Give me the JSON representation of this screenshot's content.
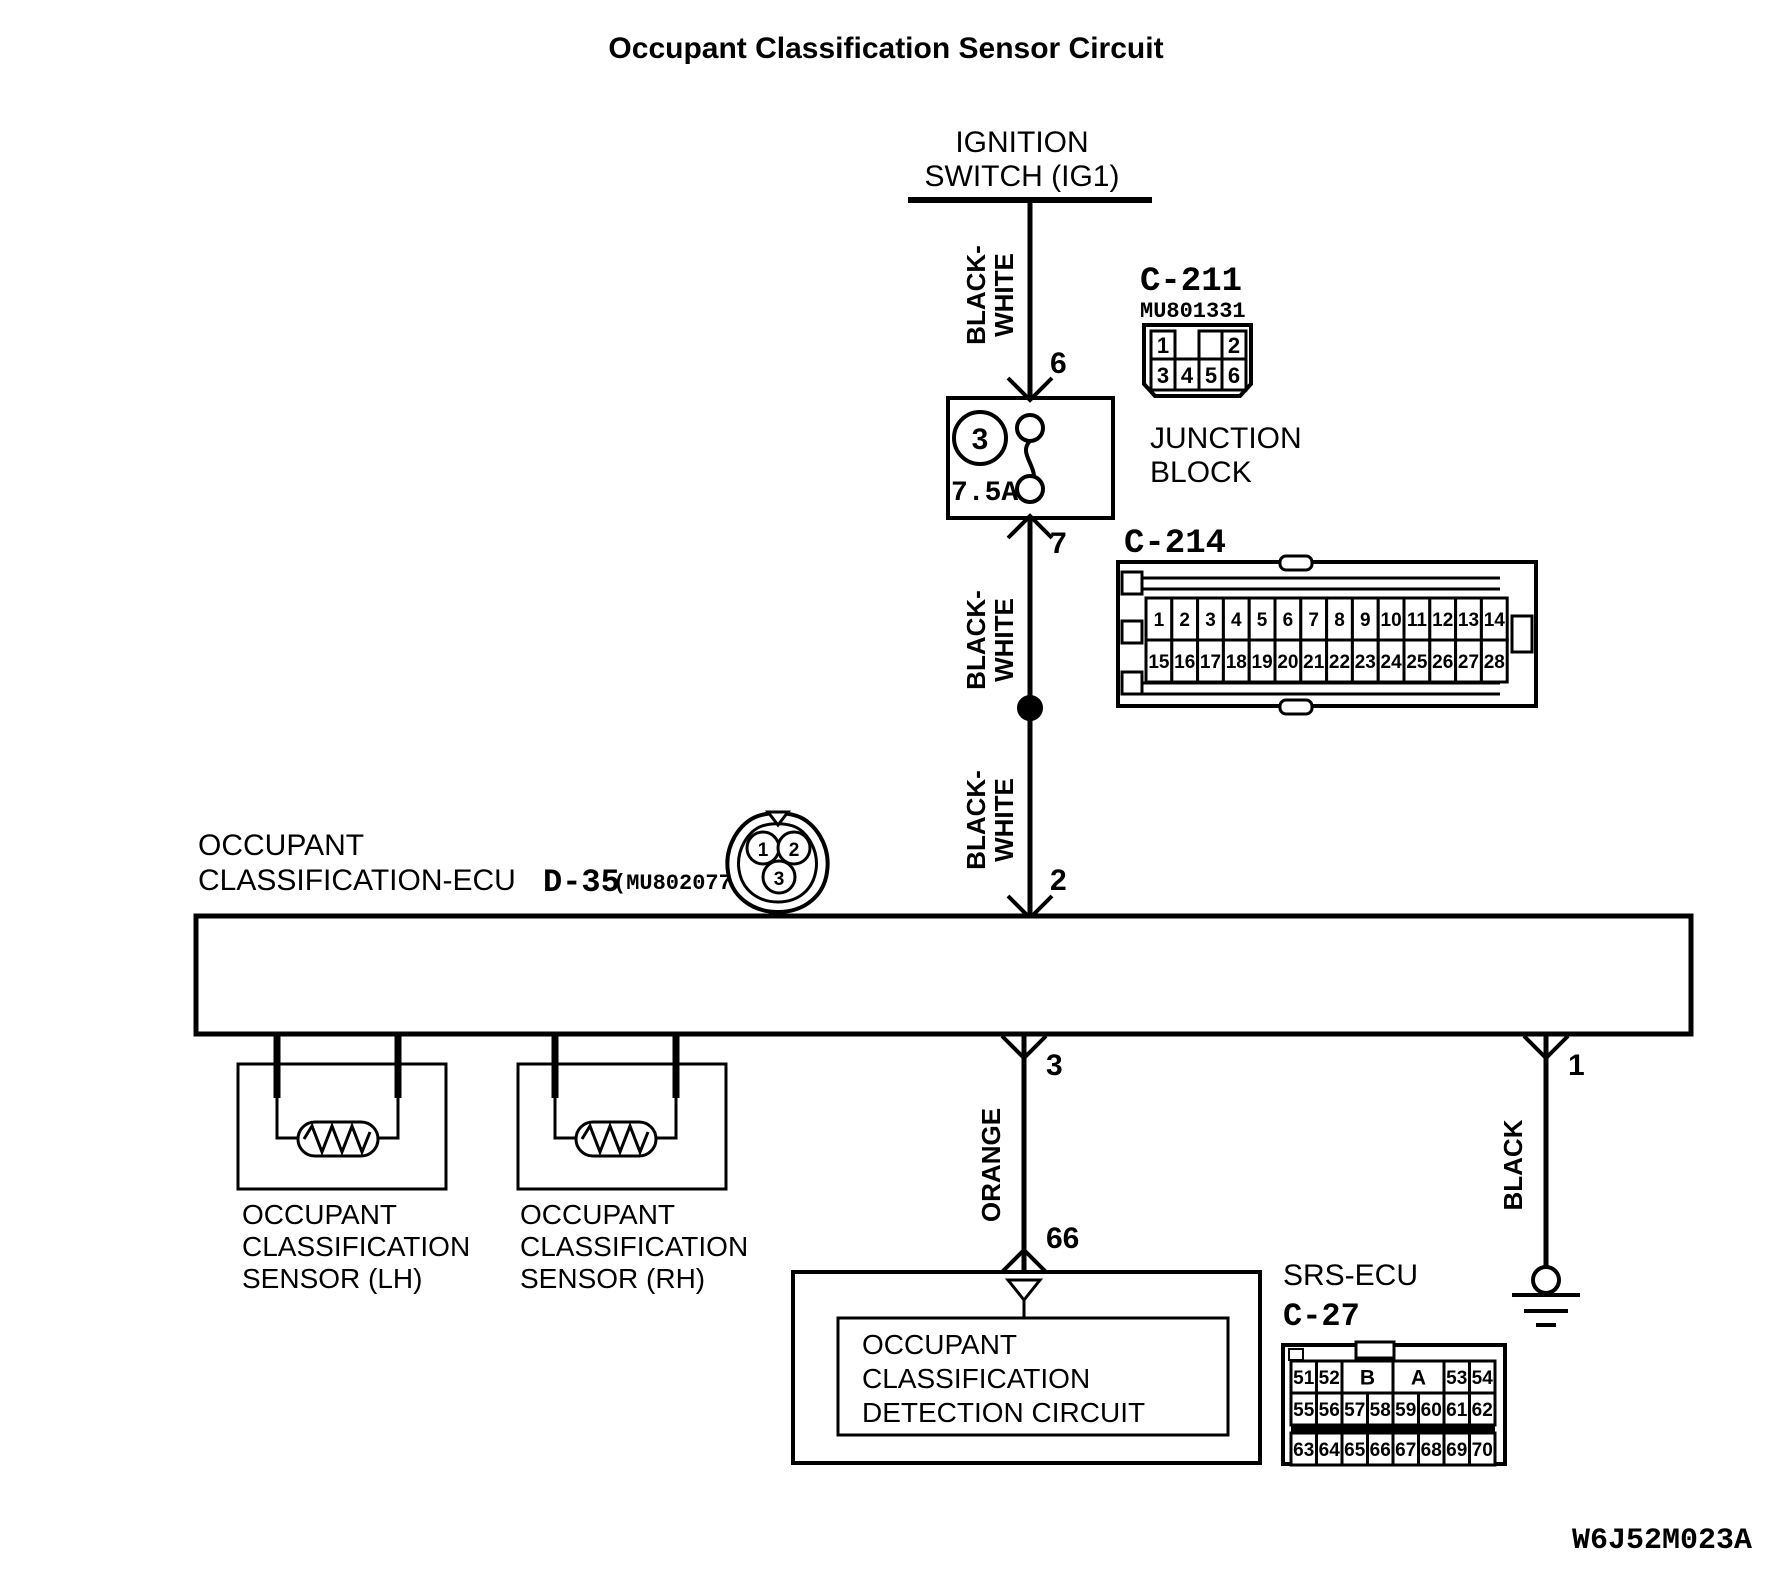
{
  "document": {
    "title": "Occupant Classification Sensor Circuit",
    "figure_code": "W6J52M023A"
  },
  "power_source": {
    "label_line1": "IGNITION",
    "label_line2": "SWITCH (IG1)"
  },
  "junction_block": {
    "label_line1": "JUNCTION",
    "label_line2": "BLOCK",
    "fuse_number": "3",
    "fuse_rating": "7.5A",
    "input_pin": "6",
    "output_pin": "7"
  },
  "connectors": [
    {
      "id": "c211",
      "name": "C-211",
      "part_number": "MU801331",
      "row_top": [
        "1",
        "",
        "",
        "2"
      ],
      "row_bottom": [
        "3",
        "4",
        "5",
        "6"
      ]
    },
    {
      "id": "c214",
      "name": "C-214",
      "part_number": "",
      "row_top": [
        "1",
        "2",
        "3",
        "4",
        "5",
        "6",
        "7",
        "8",
        "9",
        "10",
        "11",
        "12",
        "13",
        "14"
      ],
      "row_bottom": [
        "15",
        "16",
        "17",
        "18",
        "19",
        "20",
        "21",
        "22",
        "23",
        "24",
        "25",
        "26",
        "27",
        "28"
      ]
    },
    {
      "id": "d35",
      "name": "D-35",
      "part_number": "(MU802077)",
      "pins": [
        "1",
        "2",
        "3"
      ]
    },
    {
      "id": "c27",
      "name": "C-27",
      "part_number": "",
      "row_1": [
        "51",
        "52",
        "B",
        "A",
        "53",
        "54"
      ],
      "row_2": [
        "55",
        "56",
        "57",
        "58",
        "59",
        "60",
        "61",
        "62"
      ],
      "row_3": [
        "63",
        "64",
        "65",
        "66",
        "67",
        "68",
        "69",
        "70"
      ]
    }
  ],
  "ecu": {
    "label_line1": "OCCUPANT",
    "label_line2": "CLASSIFICATION-ECU",
    "connector_name": "D-35",
    "connector_part": "(MU802077)"
  },
  "srs_ecu": {
    "label": "SRS-ECU",
    "connector_name": "C-27",
    "inner_box_line1": "OCCUPANT",
    "inner_box_line2": "CLASSIFICATION",
    "inner_box_line3": "DETECTION CIRCUIT"
  },
  "sensors": [
    {
      "id": "lh",
      "line1": "OCCUPANT",
      "line2": "CLASSIFICATION",
      "line3": "SENSOR (LH)"
    },
    {
      "id": "rh",
      "line1": "OCCUPANT",
      "line2": "CLASSIFICATION",
      "line3": "SENSOR (RH)"
    }
  ],
  "wires": [
    {
      "id": "w1",
      "color_line1": "BLACK-",
      "color_line2": "WHITE",
      "from_pin": "",
      "to_pin": "6"
    },
    {
      "id": "w2",
      "color_line1": "BLACK-",
      "color_line2": "WHITE",
      "from_pin": "7",
      "to_pin": ""
    },
    {
      "id": "w3",
      "color_line1": "BLACK-",
      "color_line2": "WHITE",
      "from_pin": "",
      "to_pin": "2"
    },
    {
      "id": "w4",
      "color_line1": "ORANGE",
      "color_line2": "",
      "from_pin": "3",
      "to_pin": "66"
    },
    {
      "id": "w5",
      "color_line1": "BLACK",
      "color_line2": "",
      "from_pin": "1",
      "to_pin": ""
    }
  ],
  "pins": {
    "jb_in": "6",
    "jb_out": "7",
    "ecu_power": "2",
    "ecu_signal": "3",
    "ecu_ground": "1",
    "srs_signal": "66"
  },
  "colors": {
    "ink": "#000000",
    "paper": "#ffffff"
  }
}
